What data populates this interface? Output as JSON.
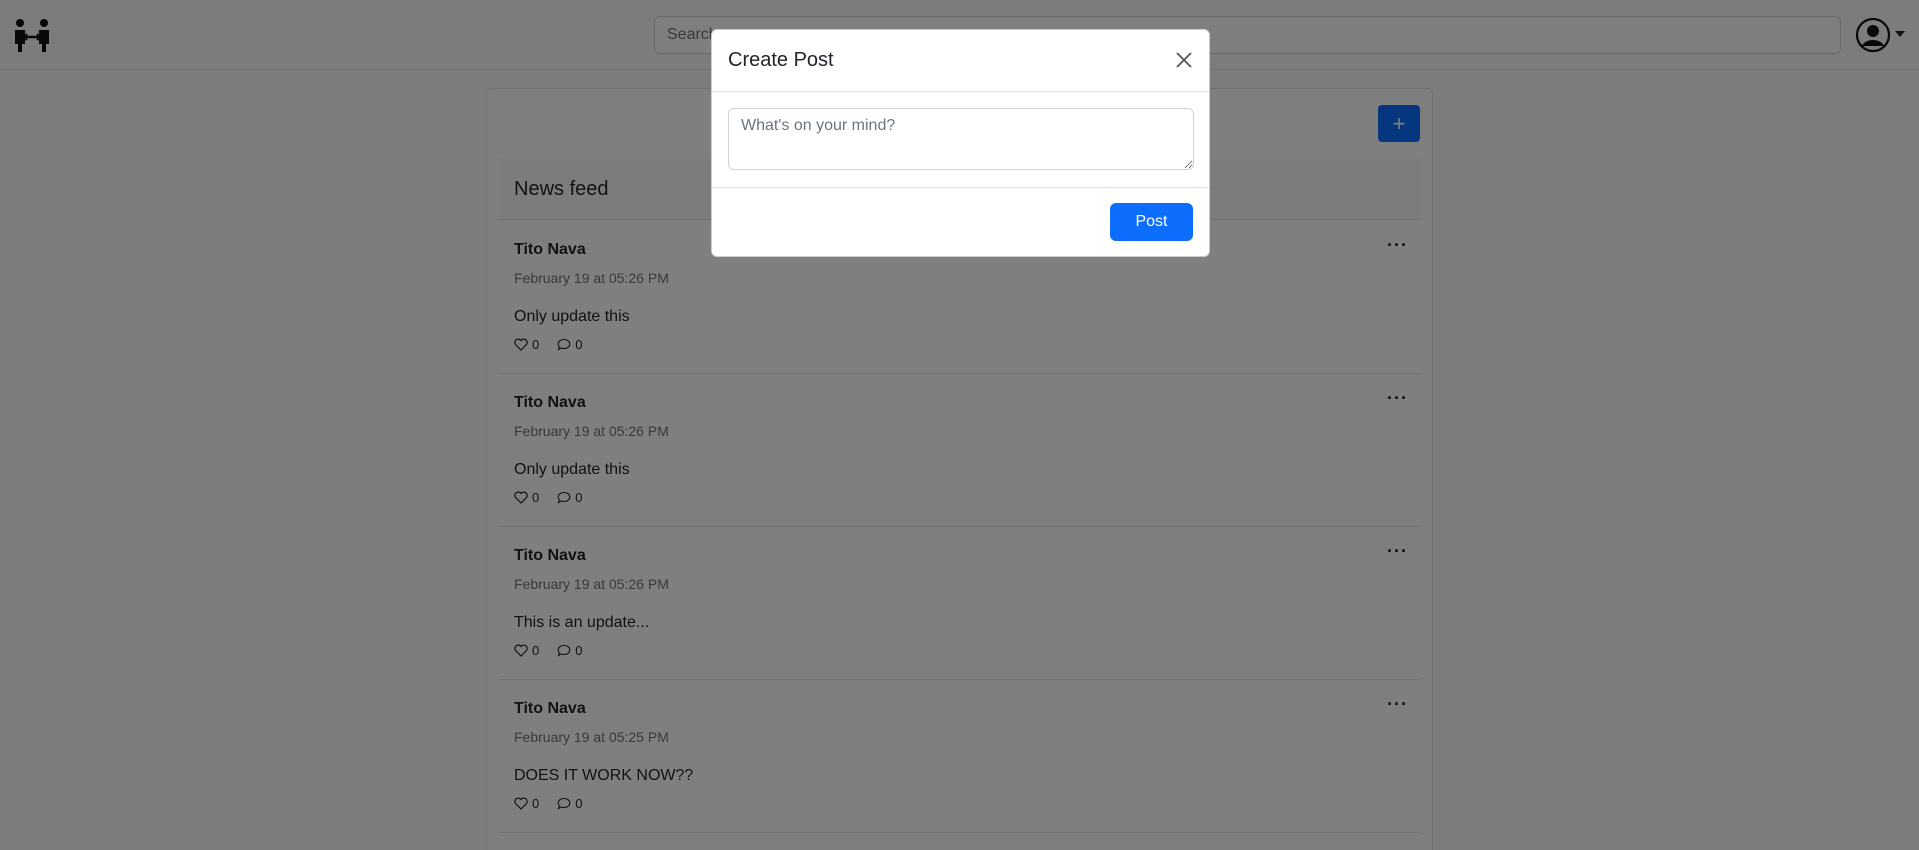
{
  "navbar": {
    "logo_icon": "people-link-icon",
    "search_placeholder": "Search",
    "account_icon": "person-circle-icon"
  },
  "feed": {
    "title": "News feed",
    "add_label": "+",
    "posts": [
      {
        "author": "Tito Nava",
        "date": "February 19 at 05:26 PM",
        "text": "Only update this",
        "likes": "0",
        "comments": "0",
        "menu": "···"
      },
      {
        "author": "Tito Nava",
        "date": "February 19 at 05:26 PM",
        "text": "Only update this",
        "likes": "0",
        "comments": "0",
        "menu": "···"
      },
      {
        "author": "Tito Nava",
        "date": "February 19 at 05:26 PM",
        "text": "This is an update...",
        "likes": "0",
        "comments": "0",
        "menu": "···"
      },
      {
        "author": "Tito Nava",
        "date": "February 19 at 05:25 PM",
        "text": "DOES IT WORK NOW??",
        "likes": "0",
        "comments": "0",
        "menu": "···"
      }
    ]
  },
  "modal": {
    "title": "Create Post",
    "placeholder": "What's on your mind?",
    "post_label": "Post"
  },
  "colors": {
    "primary": "#0d6efd",
    "backdrop": "rgba(0,0,0,0.5)"
  }
}
